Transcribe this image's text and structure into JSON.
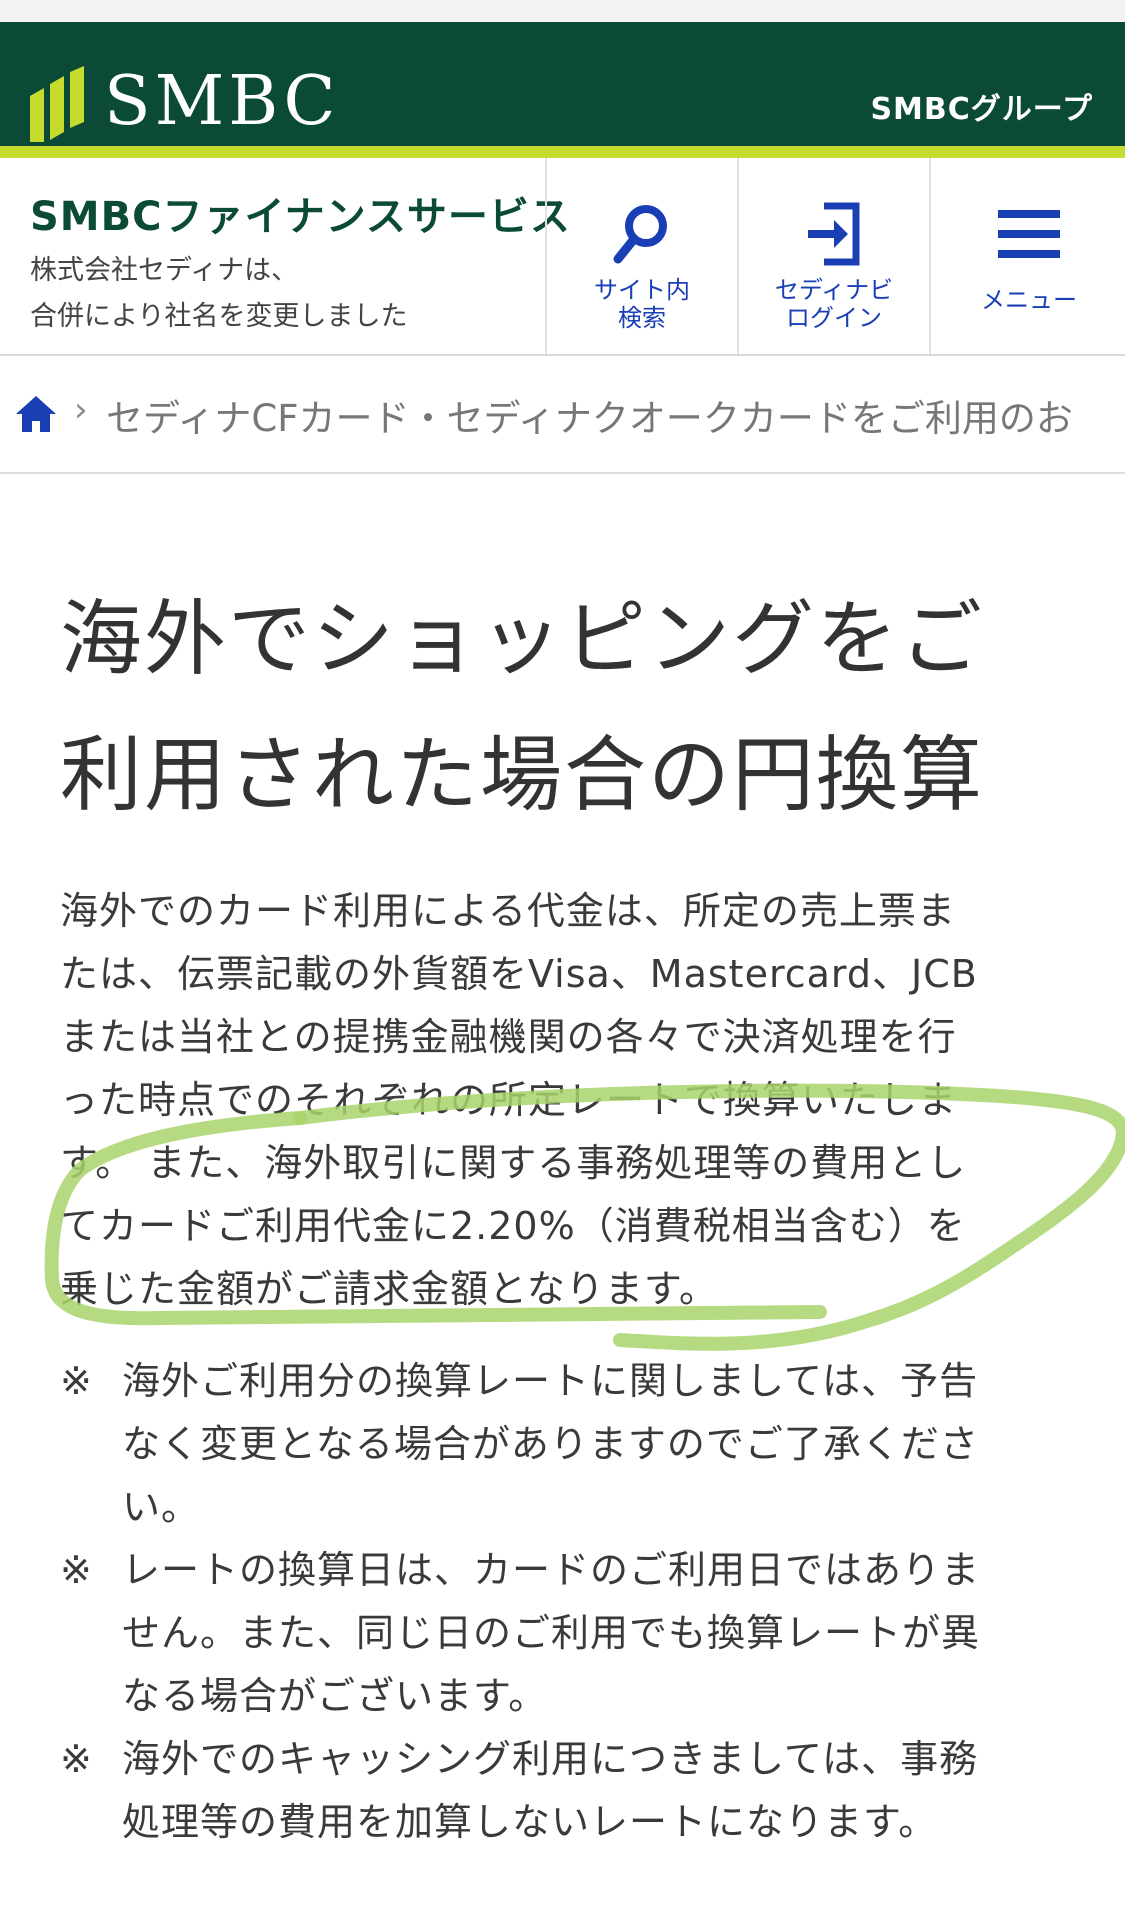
{
  "header": {
    "logo": "SMBC",
    "group": "SMBCグループ"
  },
  "subheader": {
    "brand": "SMBCファイナンスサービス",
    "note_line1": "株式会社セディナは、",
    "note_line2": "合併により社名を変更しました"
  },
  "nav": {
    "search": {
      "line1": "サイト内",
      "line2": "検索",
      "icon": "search-icon"
    },
    "login": {
      "line1": "セディナビ",
      "line2": "ログイン",
      "icon": "login-icon"
    },
    "menu": {
      "line1": "メニュー",
      "icon": "hamburger-icon"
    }
  },
  "breadcrumb": {
    "current": "セディナCFカード・セディナクオークカードをご利用のお"
  },
  "title": {
    "line1": "海外でショッピングをご",
    "line2": "利用された場合の円換算"
  },
  "body": {
    "lines": [
      "海外でのカード利用による代金は、所定の売上票ま",
      "たは、伝票記載の外貨額をVisa、Mastercard、JCB",
      "または当社との提携金融機関の各々で決済処理を行",
      "った時点でのそれぞれの所定レートで換算いたしま",
      "す。 また、海外取引に関する事務処理等の費用とし",
      "てカードご利用代金に2.20%（消費税相当含む）を",
      "乗じた金額がご請求金額となります。"
    ]
  },
  "notes": [
    {
      "mark": "※",
      "lines": [
        "海外ご利用分の換算レートに関しましては、予告",
        "なく変更となる場合がありますのでご了承くださ",
        "い。"
      ]
    },
    {
      "mark": "※",
      "lines": [
        "レートの換算日は、カードのご利用日ではありま",
        "せん。また、同じ日のご利用でも換算レートが異",
        "なる場合がございます。"
      ]
    },
    {
      "mark": "※",
      "lines": [
        "海外でのキャッシング利用につきましては、事務",
        "処理等の費用を加算しないレートになります。"
      ]
    }
  ],
  "colors": {
    "header_bg": "#0b4a36",
    "accent": "#c5dc2e",
    "nav_blue": "#1a3fb5",
    "highlight": "#a9d36b"
  }
}
